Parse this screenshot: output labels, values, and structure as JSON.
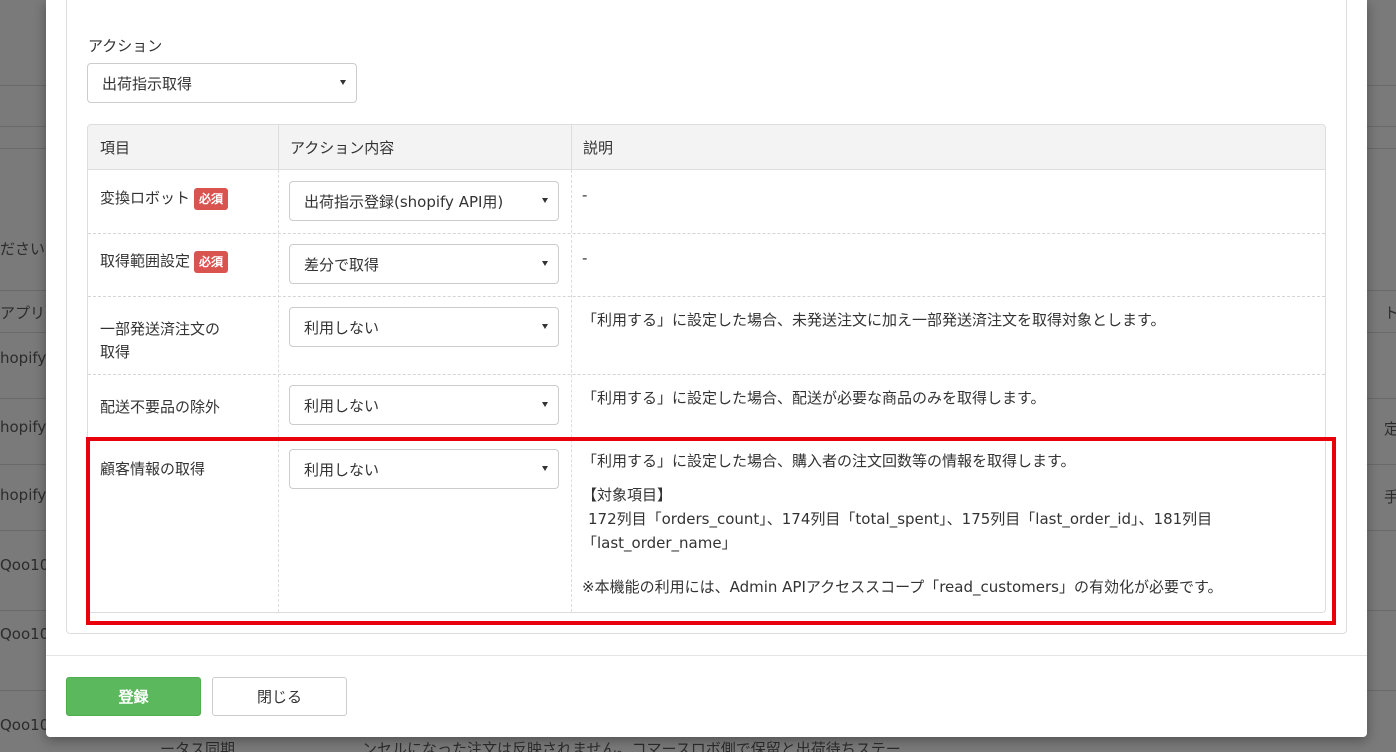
{
  "background": {
    "rows_left": [
      "ださい",
      "アプリ",
      "hopify",
      "hopify",
      "hopify",
      "Qoo10",
      "Qoo10",
      "Qoo10"
    ],
    "rows_right": [
      "ト",
      "定",
      "手"
    ],
    "bottom_partial": [
      "ータス同期",
      "ンセルになった注文は反映されません。コマースロボ側で保留と出荷待ちステー"
    ]
  },
  "modal": {
    "action_label": "アクション",
    "action_select": "出荷指示取得",
    "table": {
      "headers": [
        "項目",
        "アクション内容",
        "説明"
      ],
      "required_badge": "必須",
      "rows": [
        {
          "item": "変換ロボット",
          "required": true,
          "select": "出荷指示登録(shopify API用)",
          "desc": "-"
        },
        {
          "item": "取得範囲設定",
          "required": true,
          "select": "差分で取得",
          "desc": "-"
        },
        {
          "item_line1": "一部発送済注文の",
          "item_line2": "取得",
          "select": "利用しない",
          "desc": "「利用する」に設定した場合、未発送注文に加え一部発送済注文を取得対象とします。"
        },
        {
          "item": "配送不要品の除外",
          "select": "利用しない",
          "desc": "「利用する」に設定した場合、配送が必要な商品のみを取得します。"
        },
        {
          "item": "顧客情報の取得",
          "select": "利用しない",
          "desc": "「利用する」に設定した場合、購入者の注文回数等の情報を取得します。",
          "target_heading": "【対象項目】",
          "target_line1": "172列目「orders_count」、174列目「total_spent」、175列目「last_order_id」、181列目",
          "target_line2": "「last_order_name」",
          "note": "※本機能の利用には、Admin APIアクセススコープ「read_customers」の有効化が必要です。"
        }
      ]
    },
    "buttons": {
      "register": "登録",
      "close": "閉じる"
    }
  },
  "colors": {
    "primary": "#5cb85c",
    "badge": "#d9534f",
    "highlight": "#e8000a"
  }
}
